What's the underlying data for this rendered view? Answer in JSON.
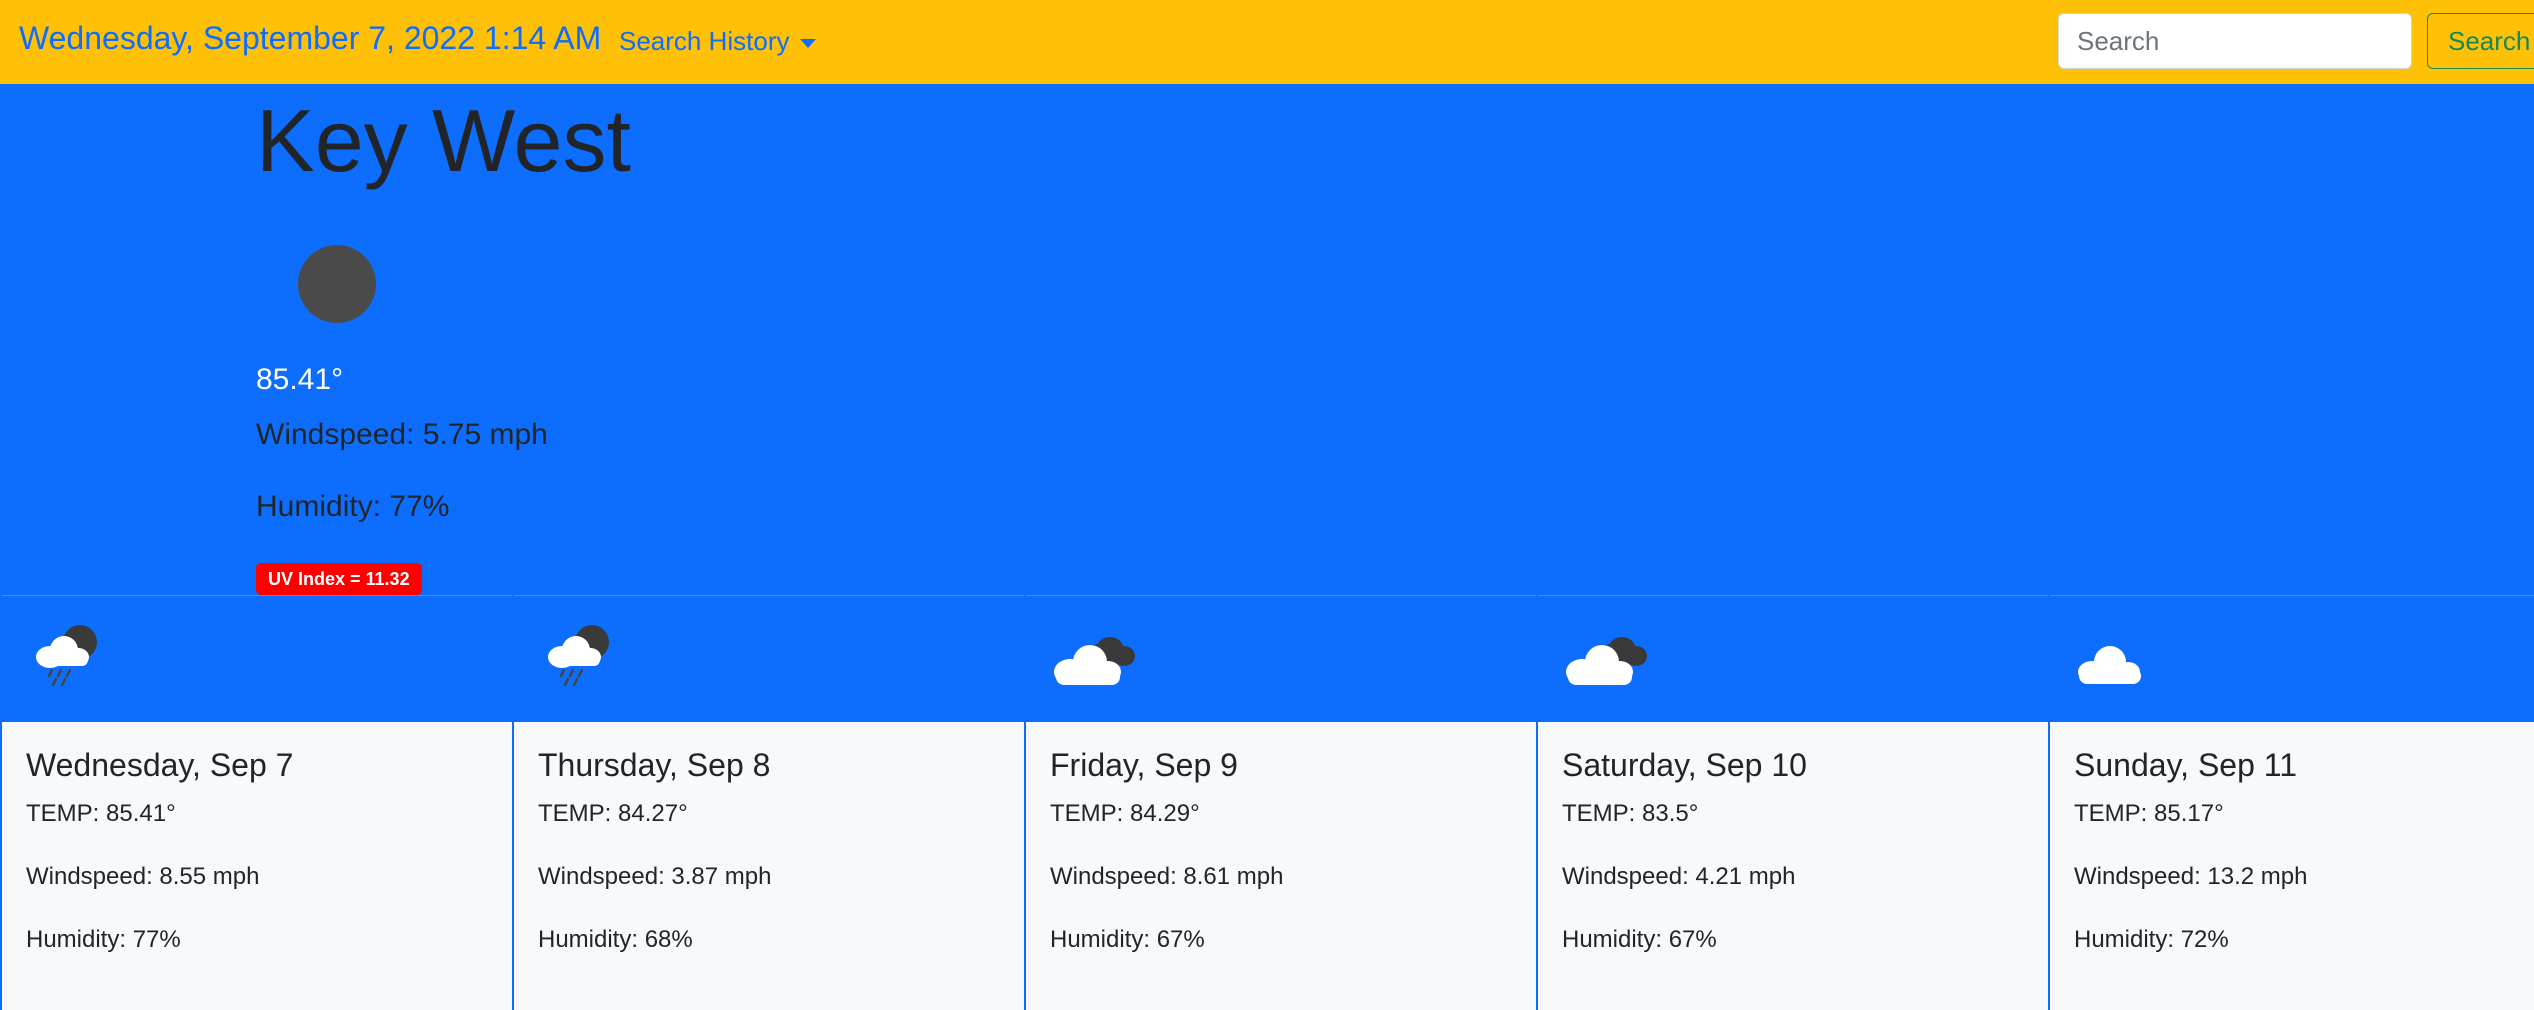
{
  "navbar": {
    "datetime": "Wednesday, September 7, 2022 1:14 AM",
    "history_label": "Search History",
    "search_placeholder": "Search",
    "search_button": "Search"
  },
  "current": {
    "city": "Key West",
    "icon": "dark-circle-icon",
    "temp": "85.41°",
    "wind": "Windspeed: 5.75 mph",
    "humidity": "Humidity: 77%",
    "uv": "UV Index = 11.32"
  },
  "colors": {
    "navbar_bg": "#ffc107",
    "page_bg": "#0d6efd",
    "uv_badge": "#ff0000",
    "search_button": "#198754"
  },
  "forecast": [
    {
      "icon": "rain-cloud-moon-icon",
      "day": "Wednesday, Sep 7",
      "temp": "TEMP: 85.41°",
      "wind": "Windspeed: 8.55 mph",
      "humidity": "Humidity: 77%"
    },
    {
      "icon": "rain-cloud-moon-icon",
      "day": "Thursday, Sep 8",
      "temp": "TEMP: 84.27°",
      "wind": "Windspeed: 3.87 mph",
      "humidity": "Humidity: 68%"
    },
    {
      "icon": "broken-clouds-icon",
      "day": "Friday, Sep 9",
      "temp": "TEMP: 84.29°",
      "wind": "Windspeed: 8.61 mph",
      "humidity": "Humidity: 67%"
    },
    {
      "icon": "broken-clouds-icon",
      "day": "Saturday, Sep 10",
      "temp": "TEMP: 83.5°",
      "wind": "Windspeed: 4.21 mph",
      "humidity": "Humidity: 67%"
    },
    {
      "icon": "cloud-icon",
      "day": "Sunday, Sep 11",
      "temp": "TEMP: 85.17°",
      "wind": "Windspeed: 13.2 mph",
      "humidity": "Humidity: 72%"
    }
  ]
}
